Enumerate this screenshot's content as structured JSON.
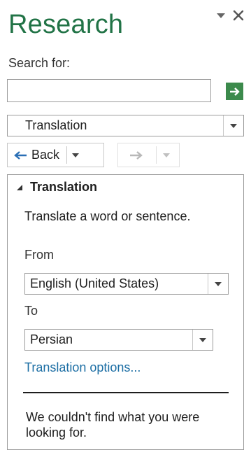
{
  "pane": {
    "title": "Research",
    "brand_color": "#217346"
  },
  "search": {
    "label": "Search for:",
    "value": "",
    "placeholder": ""
  },
  "service": {
    "selected": "Translation"
  },
  "nav": {
    "back_label": "Back"
  },
  "section": {
    "title": "Translation",
    "description": "Translate a word or sentence.",
    "from_label": "From",
    "from_value": "English (United States)",
    "to_label": "To",
    "to_value": "Persian",
    "options_link": "Translation options...",
    "message": "We couldn't find what you were looking for."
  },
  "icons": {
    "title_menu": "chevron-down-icon",
    "close": "close-icon",
    "go": "arrow-right-icon",
    "back": "arrow-left-icon",
    "forward": "arrow-right-icon",
    "section_toggle": "triangle-expanded-icon"
  }
}
